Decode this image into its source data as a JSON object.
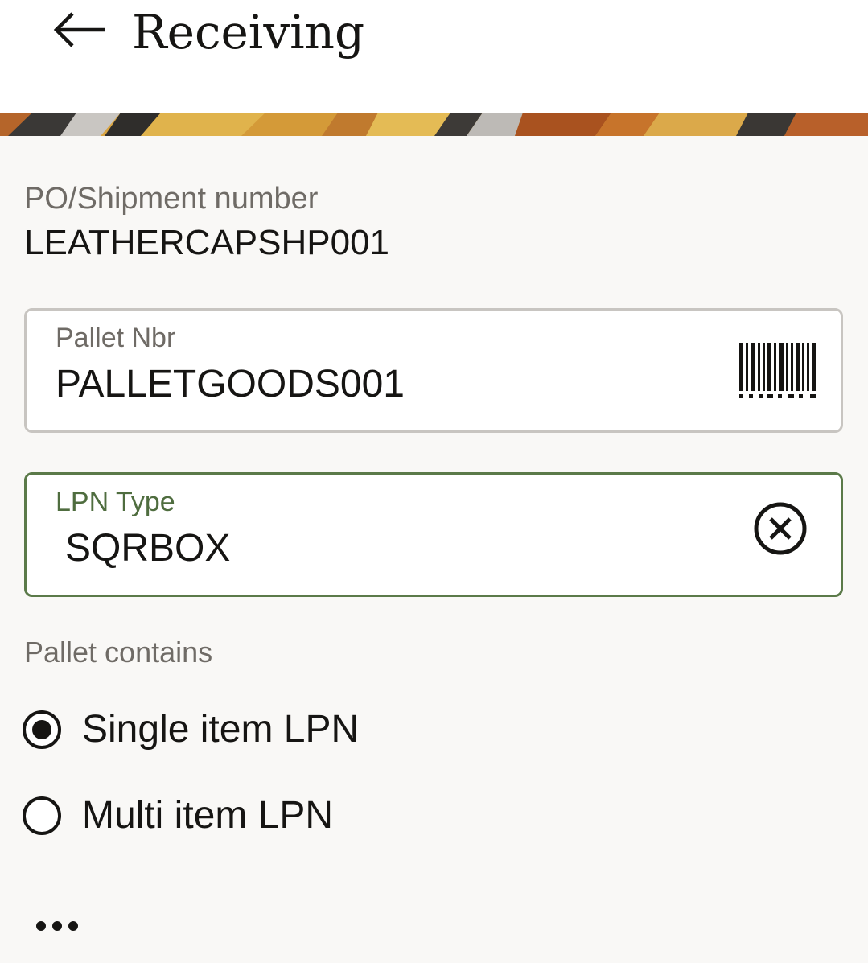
{
  "header": {
    "title": "Receiving",
    "back_icon": "arrow-left-icon"
  },
  "summary": {
    "po_label": "PO/Shipment number",
    "po_value": "LEATHERCAPSHP001"
  },
  "pallet_field": {
    "label": "Pallet Nbr",
    "value": "PALLETGOODS001",
    "action_icon": "barcode-icon"
  },
  "lpn_type_field": {
    "label": "LPN Type",
    "value": "SQRBOX",
    "action_icon": "clear-icon",
    "accent_color": "#5b7a49"
  },
  "pallet_contains": {
    "label": "Pallet contains",
    "options": [
      {
        "label": "Single item LPN",
        "selected": true
      },
      {
        "label": "Multi item LPN",
        "selected": false
      }
    ]
  },
  "more_icon": "more-horizontal-icon"
}
